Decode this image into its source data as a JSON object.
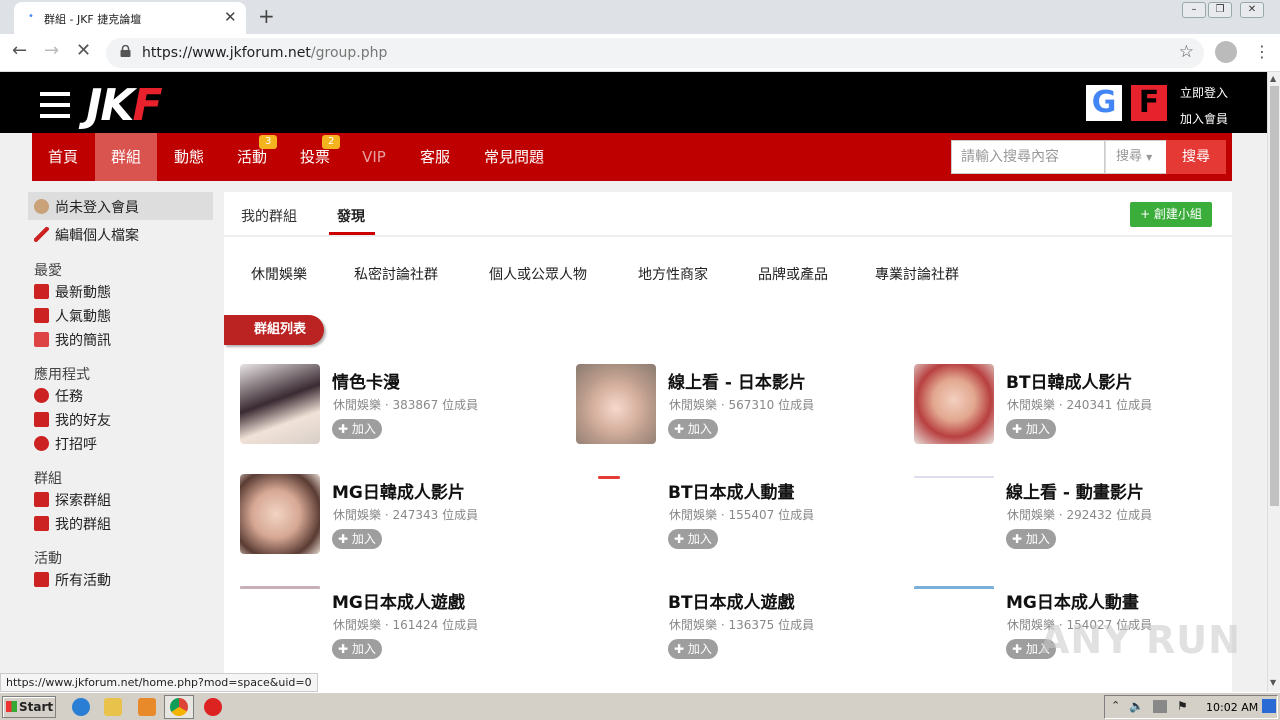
{
  "browser": {
    "tab_title": "群組 - JKF 捷克論壇",
    "tab_favicon": "•",
    "url_host": "https://www.jkforum.net",
    "url_path": "/group.php"
  },
  "header": {
    "logo_main": "JK",
    "logo_accent": "F",
    "google_glyph": "G",
    "facebook_glyph": "F",
    "login": "立即登入",
    "join": "加入會員"
  },
  "nav": {
    "items": [
      "首頁",
      "群組",
      "動態",
      "活動",
      "投票",
      "VIP",
      "客服",
      "常見問題"
    ],
    "badge_activity": "3",
    "badge_vote": "2",
    "search_placeholder": "請輸入搜尋內容",
    "search_type": "搜尋",
    "search_button": "搜尋"
  },
  "sidebar": {
    "user": "尚未登入會員",
    "edit_profile": "編輯個人檔案",
    "favorites_heading": "最愛",
    "favorites": [
      "最新動態",
      "人氣動態",
      "我的簡訊"
    ],
    "apps_heading": "應用程式",
    "apps": [
      "任務",
      "我的好友",
      "打招呼"
    ],
    "groups_heading": "群組",
    "groups": [
      "探索群組",
      "我的群組"
    ],
    "events_heading": "活動",
    "events": [
      "所有活動"
    ]
  },
  "content": {
    "tab_my_groups": "我的群組",
    "tab_discover": "發現",
    "create_button": "+ 創建小組",
    "categories": [
      "休閒娛樂",
      "私密討論社群",
      "個人或公眾人物",
      "地方性商家",
      "品牌或產品",
      "專業討論社群"
    ],
    "list_title": "群組列表",
    "join_label": "加入",
    "groups": [
      {
        "name": "情色卡漫",
        "meta": "休閒娛樂 · 383867 位成員"
      },
      {
        "name": "線上看 - 日本影片",
        "meta": "休閒娛樂 · 567310 位成員"
      },
      {
        "name": "BT日韓成人影片",
        "meta": "休閒娛樂 · 240341 位成員"
      },
      {
        "name": "MG日韓成人影片",
        "meta": "休閒娛樂 · 247343 位成員"
      },
      {
        "name": "BT日本成人動畫",
        "meta": "休閒娛樂 · 155407 位成員"
      },
      {
        "name": "線上看 - 動畫影片",
        "meta": "休閒娛樂 · 292432 位成員"
      },
      {
        "name": "MG日本成人遊戲",
        "meta": "休閒娛樂 · 161424 位成員"
      },
      {
        "name": "BT日本成人遊戲",
        "meta": "休閒娛樂 · 136375 位成員"
      },
      {
        "name": "MG日本成人動畫",
        "meta": "休閒娛樂 · 154027 位成員"
      }
    ]
  },
  "statusbar": "https://www.jkforum.net/home.php?mod=space&uid=0",
  "watermark": "ANY RUN",
  "taskbar": {
    "start": "Start",
    "clock": "10:02 AM"
  },
  "colors": {
    "nav_red": "#bf0000",
    "accent_red": "#e53935",
    "badge_yellow": "#f5b320",
    "create_green": "#3bad3b"
  }
}
